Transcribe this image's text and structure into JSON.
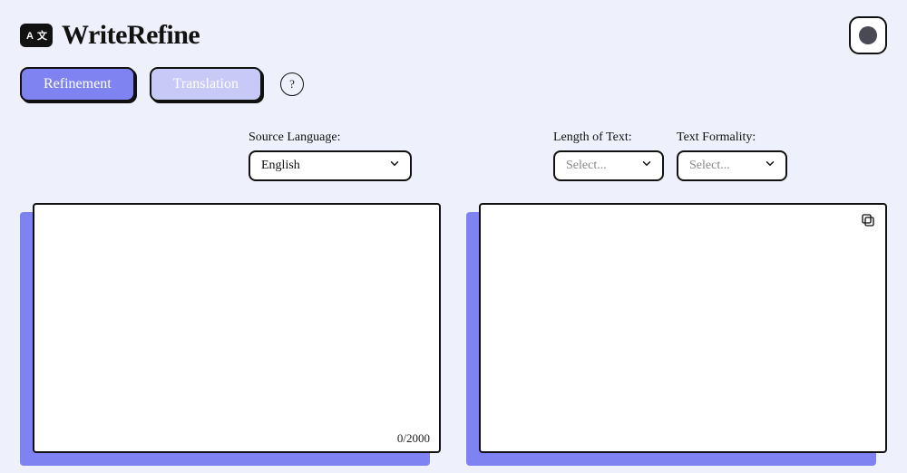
{
  "brand": {
    "name": "WriteRefine",
    "logo_text": "A⇄"
  },
  "theme_toggle": {
    "label": "toggle-theme"
  },
  "tabs": {
    "refinement": "Refinement",
    "translation": "Translation",
    "active": "refinement"
  },
  "help": {
    "label": "?"
  },
  "controls": {
    "source_language": {
      "label": "Source Language:",
      "value": "English"
    },
    "length": {
      "label": "Length of Text:",
      "placeholder": "Select..."
    },
    "formality": {
      "label": "Text Formality:",
      "placeholder": "Select..."
    }
  },
  "editor": {
    "char_count": "0/2000"
  }
}
